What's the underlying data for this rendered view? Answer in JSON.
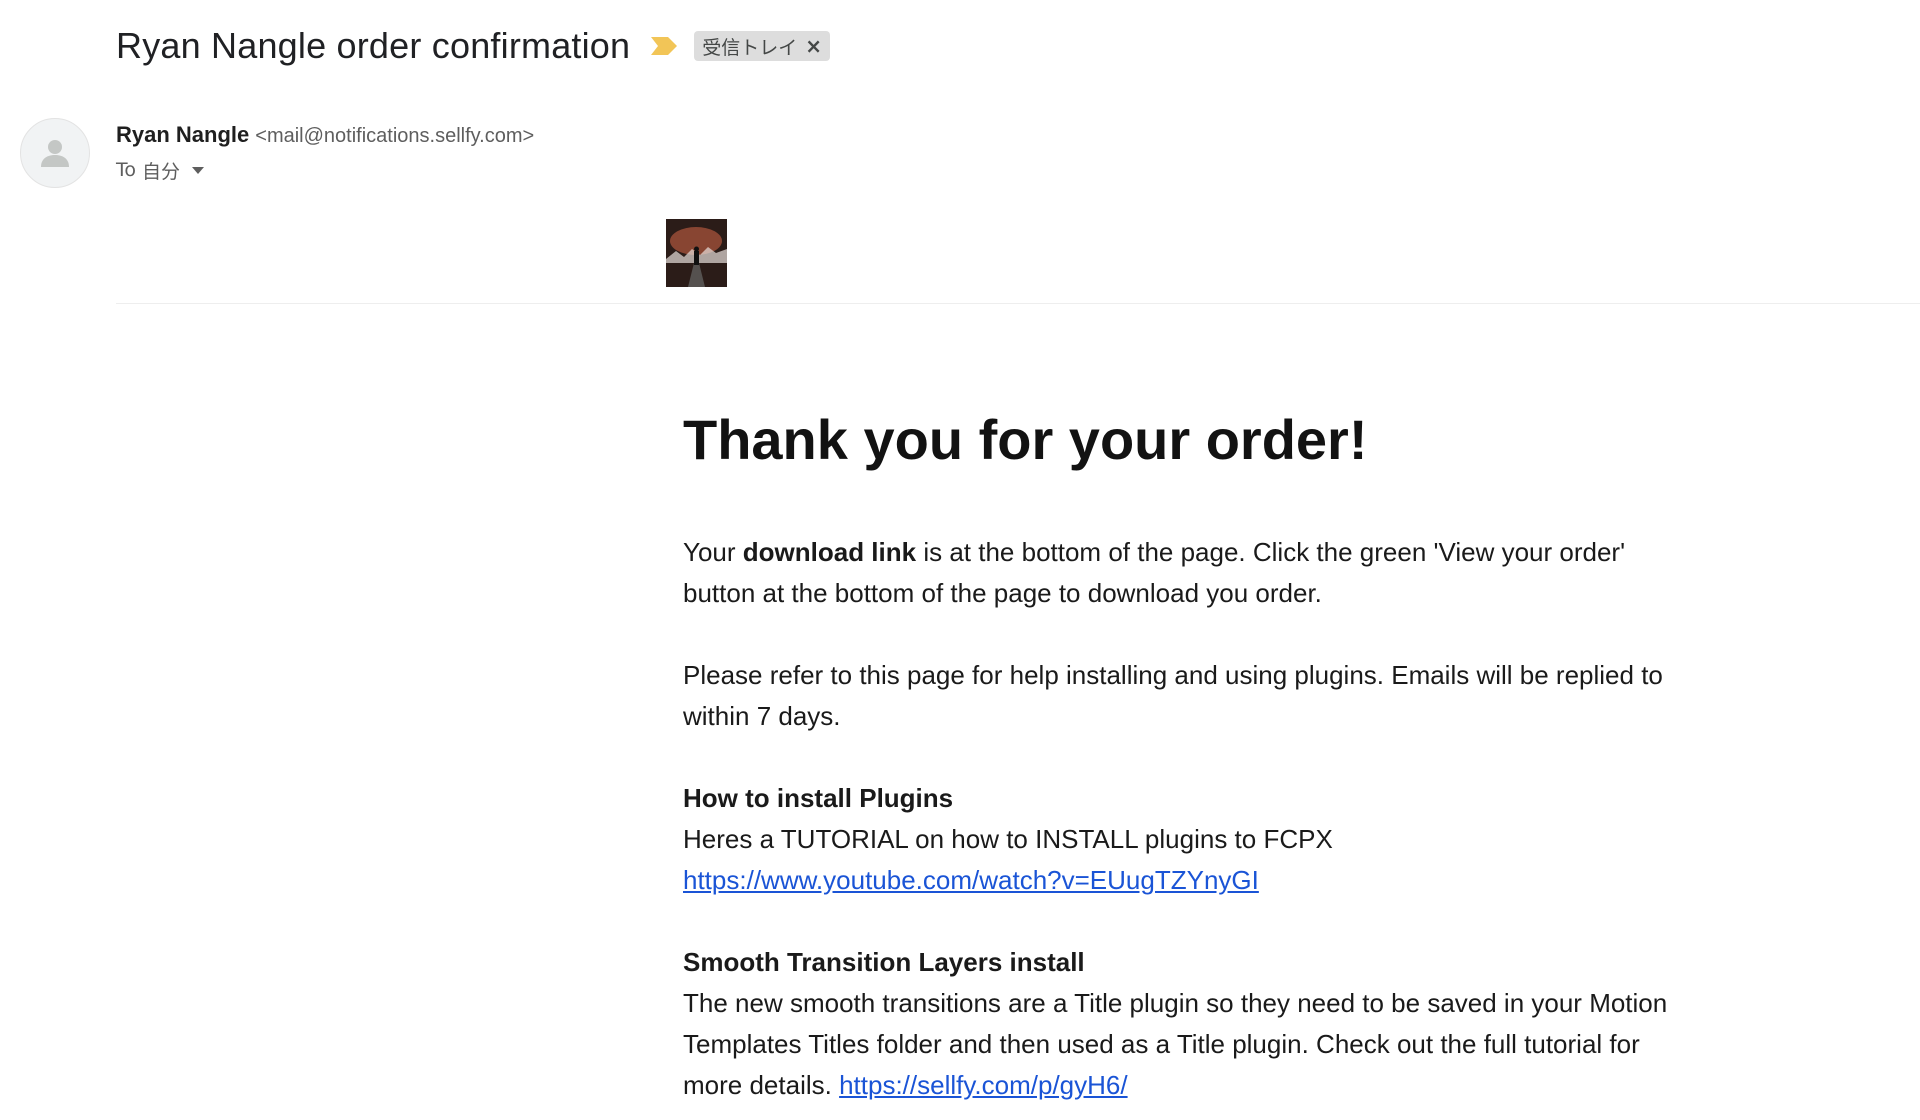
{
  "subject": {
    "title": "Ryan Nangle order confirmation",
    "importance_color": "#f2c557",
    "label": "受信トレイ",
    "label_close": "×"
  },
  "sender": {
    "name": "Ryan Nangle",
    "email": "<mail@notifications.sellfy.com>",
    "to_prefix": "To",
    "to_value": "自分"
  },
  "body": {
    "heading": "Thank you for your order!",
    "para1_start": "Your ",
    "para1_bold": "download link",
    "para1_end": " is at the bottom of the page. Click the green 'View your order' button at the bottom of the page to download you order.",
    "para2": "Please refer to this page for help installing and using plugins. Emails will be replied to within 7 days.",
    "section1_title": "How to install Plugins",
    "section1_text": "Heres a TUTORIAL on how to INSTALL plugins to FCPX",
    "section1_link": "https://www.youtube.com/watch?v=EUugTZYnyGI",
    "section2_title": "Smooth Transition Layers install",
    "section2_text": "The new smooth transitions are a Title plugin so they need to be saved in your Motion Templates Titles folder and then used as a Title plugin. Check out the full tutorial for more details. ",
    "section2_link": "https://sellfy.com/p/gyH6/"
  },
  "colors": {
    "link": "#1a54d6",
    "chip_bg": "#dddddd"
  }
}
